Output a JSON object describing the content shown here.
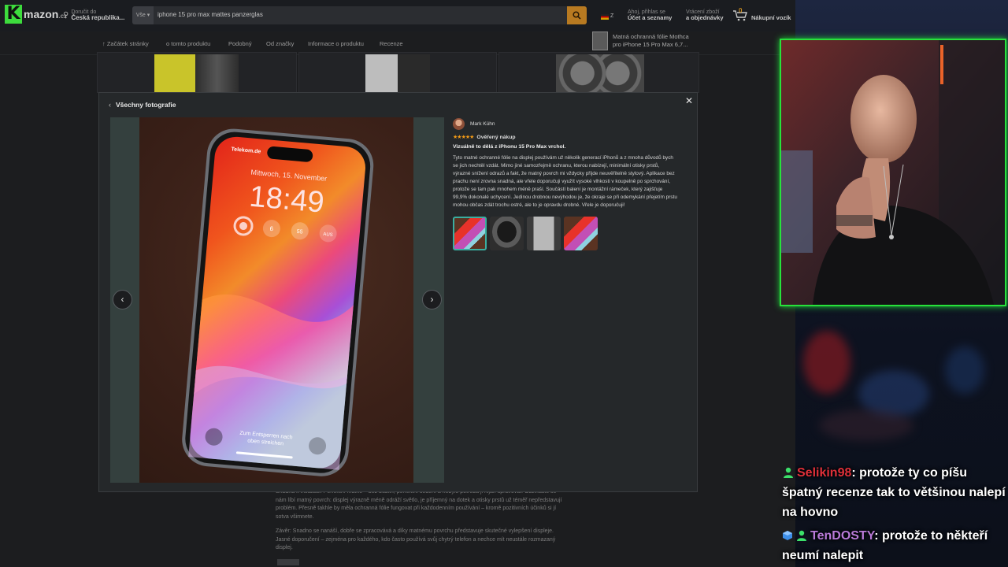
{
  "amazon": {
    "logo_text": "mazon",
    "logo_suffix": ".cz",
    "deliver_line1": "Doručit do",
    "deliver_line2": "Česká republika...",
    "search_category": "Vše",
    "search_query": "iphone 15 pro max mattes panzerglas",
    "flag_label": "Z",
    "account_line1": "Ahoj, přihlas se",
    "account_line2": "Účet a seznamy",
    "returns_line1": "Vrácení zboží",
    "returns_line2": "a objednávky",
    "cart_count": "0",
    "cart_label": "Nákupní vozík"
  },
  "subnav": {
    "items": [
      "Začátek stránky",
      "o tomto produktu",
      "Podobný",
      "Od značky",
      "Informace o produktu",
      "Recenze"
    ],
    "product_line1": "Matná ochranná fólie Mothca",
    "product_line2": "pro iPhone 15 Pro Max 6,7..."
  },
  "page_below": {
    "para1": "Snadná k instalaci. Perfektní matné – bez bublin, perfektní sedění a nebylo potřeba ji nijak upravovat. Obzvláště se nám líbí matný povrch: displej výrazně méně odráží světlo, je příjemný na dotek a otisky prstů už téměř nepředstavují problém. Přesně takhle by měla ochranná fólie fungovat při každodenním používání – kromě pozitivních účinků si jí sotva všimnete.",
    "para2": "Závěr: Snadno se nanáší, dobře se zpracovává a díky matnému povrchu představuje skutečné vylepšení displeje. Jasné doporučení – zejména pro každého, kdo často používá svůj chytrý telefon a nechce mít neustále rozmazaný displej."
  },
  "modal": {
    "back_label": "Všechny fotografie",
    "phone_carrier": "Telekom.de",
    "phone_date": "Mittwoch, 15. November",
    "phone_time": "18:49",
    "phone_widget1": "6",
    "phone_widget2": "55",
    "phone_widget3": "AUS",
    "phone_swipe1": "Zum Entsperren nach",
    "phone_swipe2": "oben streichen",
    "reviewer_name": "Mark Kühn",
    "verified": "Ověřený nákup",
    "rating": 5,
    "review_title": "Vizuálně to dělá z iPhonu 15 Pro Max vrchol.",
    "review_body": "Tyto matné ochranné fólie na displej používám už několik generací iPhonů a z mnoha důvodů bych se jich nechtěl vzdát. Mimo jiné samozřejmě ochranu, kterou nabízejí, minimální otisky prstů, výrazné snížení odrazů a fakt, že matný povrch mi vždycky přijde neuvěřitelně stylový. Aplikace bez prachu není zrovna snadná, ale vřele doporučuji využít vysoké vlhkosti v koupelně po sprchování, protože se tam pak mnohem méně praší. Součástí balení je montážní rámeček, který zajišťuje 99,9% dokonalé uchycení. Jedinou drobnou nevýhodou je, že okraje se při odemykání přejetím prstu mohou občas zdát trochu ostré, ale to je opravdu drobné. Vřele je doporučuji!",
    "thumb_count": 4
  },
  "chat": [
    {
      "user": "Selikin98",
      "user_color": "#e0303a",
      "message": ": protože ty co píšu špatný recenze tak to většinou nalepí na hovno"
    },
    {
      "user": "TenDOSTY",
      "user_color": "#b97ad8",
      "message": ": protože to někteří neumí nalepit"
    }
  ],
  "colors": {
    "webcam_border": "#27e23b",
    "star": "#f29a17",
    "thumb_selected": "#3aaea0"
  }
}
